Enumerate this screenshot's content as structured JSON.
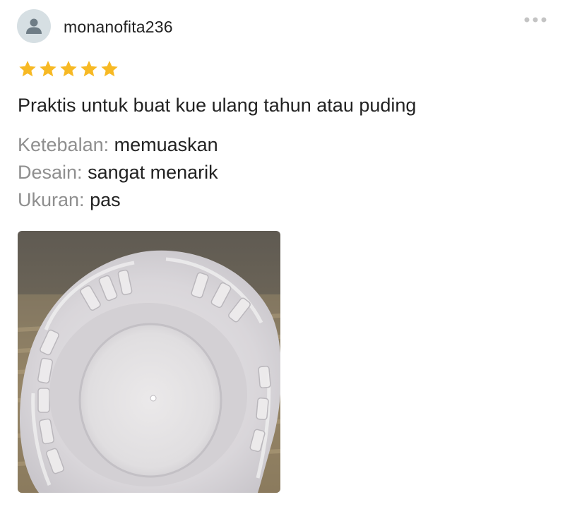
{
  "reviewer": {
    "username": "monanofita236",
    "avatar_icon": "person-icon"
  },
  "menu": {
    "icon": "more-options-icon"
  },
  "rating": {
    "value": 5,
    "max": 5,
    "star_color": "#f7b924"
  },
  "review": {
    "text": "Praktis untuk buat kue ulang tahun atau puding"
  },
  "attributes": [
    {
      "label": "Ketebalan",
      "value": "memuaskan"
    },
    {
      "label": "Desain",
      "value": "sangat menarik"
    },
    {
      "label": "Ukuran",
      "value": "pas"
    }
  ],
  "photo": {
    "icon": "cake-mold-photo"
  }
}
